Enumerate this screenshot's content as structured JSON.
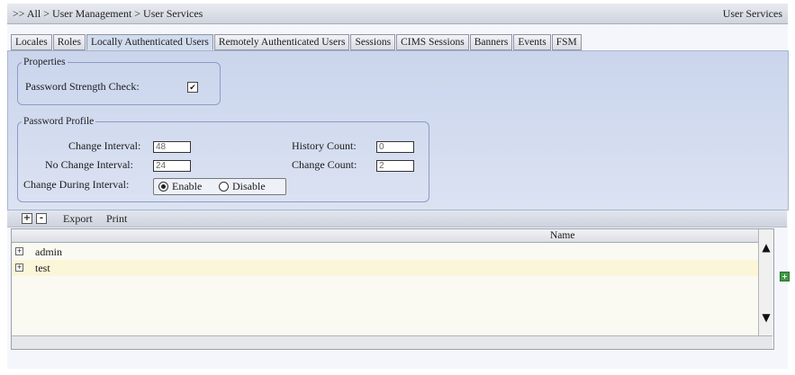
{
  "header": {
    "breadcrumb": ">> All > User Management > User Services",
    "title": "User Services"
  },
  "tabs": [
    {
      "label": "Locales"
    },
    {
      "label": "Roles"
    },
    {
      "label": "Locally Authenticated Users",
      "active": true
    },
    {
      "label": "Remotely Authenticated Users"
    },
    {
      "label": "Sessions"
    },
    {
      "label": "CIMS Sessions"
    },
    {
      "label": "Banners"
    },
    {
      "label": "Events"
    },
    {
      "label": "FSM"
    }
  ],
  "properties": {
    "legend": "Properties",
    "password_strength_label": "Password Strength Check:",
    "password_strength_checked": true
  },
  "password_profile": {
    "legend": "Password Profile",
    "change_interval_label": "Change Interval:",
    "change_interval_value": "48",
    "no_change_interval_label": "No Change Interval:",
    "no_change_interval_value": "24",
    "change_during_interval_label": "Change During Interval:",
    "enable_label": "Enable",
    "disable_label": "Disable",
    "change_during_interval_selected": "Enable",
    "history_count_label": "History Count:",
    "history_count_value": "0",
    "change_count_label": "Change Count:",
    "change_count_value": "2"
  },
  "toolbar": {
    "expand_icon": "+",
    "collapse_icon": "-",
    "export_label": "Export",
    "print_label": "Print"
  },
  "table": {
    "columns": [
      {
        "label": "Name"
      }
    ],
    "rows": [
      {
        "name": "admin",
        "expander": "+"
      },
      {
        "name": "test",
        "expander": "+",
        "selected": true
      }
    ]
  },
  "colors": {
    "panel_bg": "#cad5ec",
    "selected_row": "#fbf6d8",
    "add_button": "#3f9a45"
  }
}
